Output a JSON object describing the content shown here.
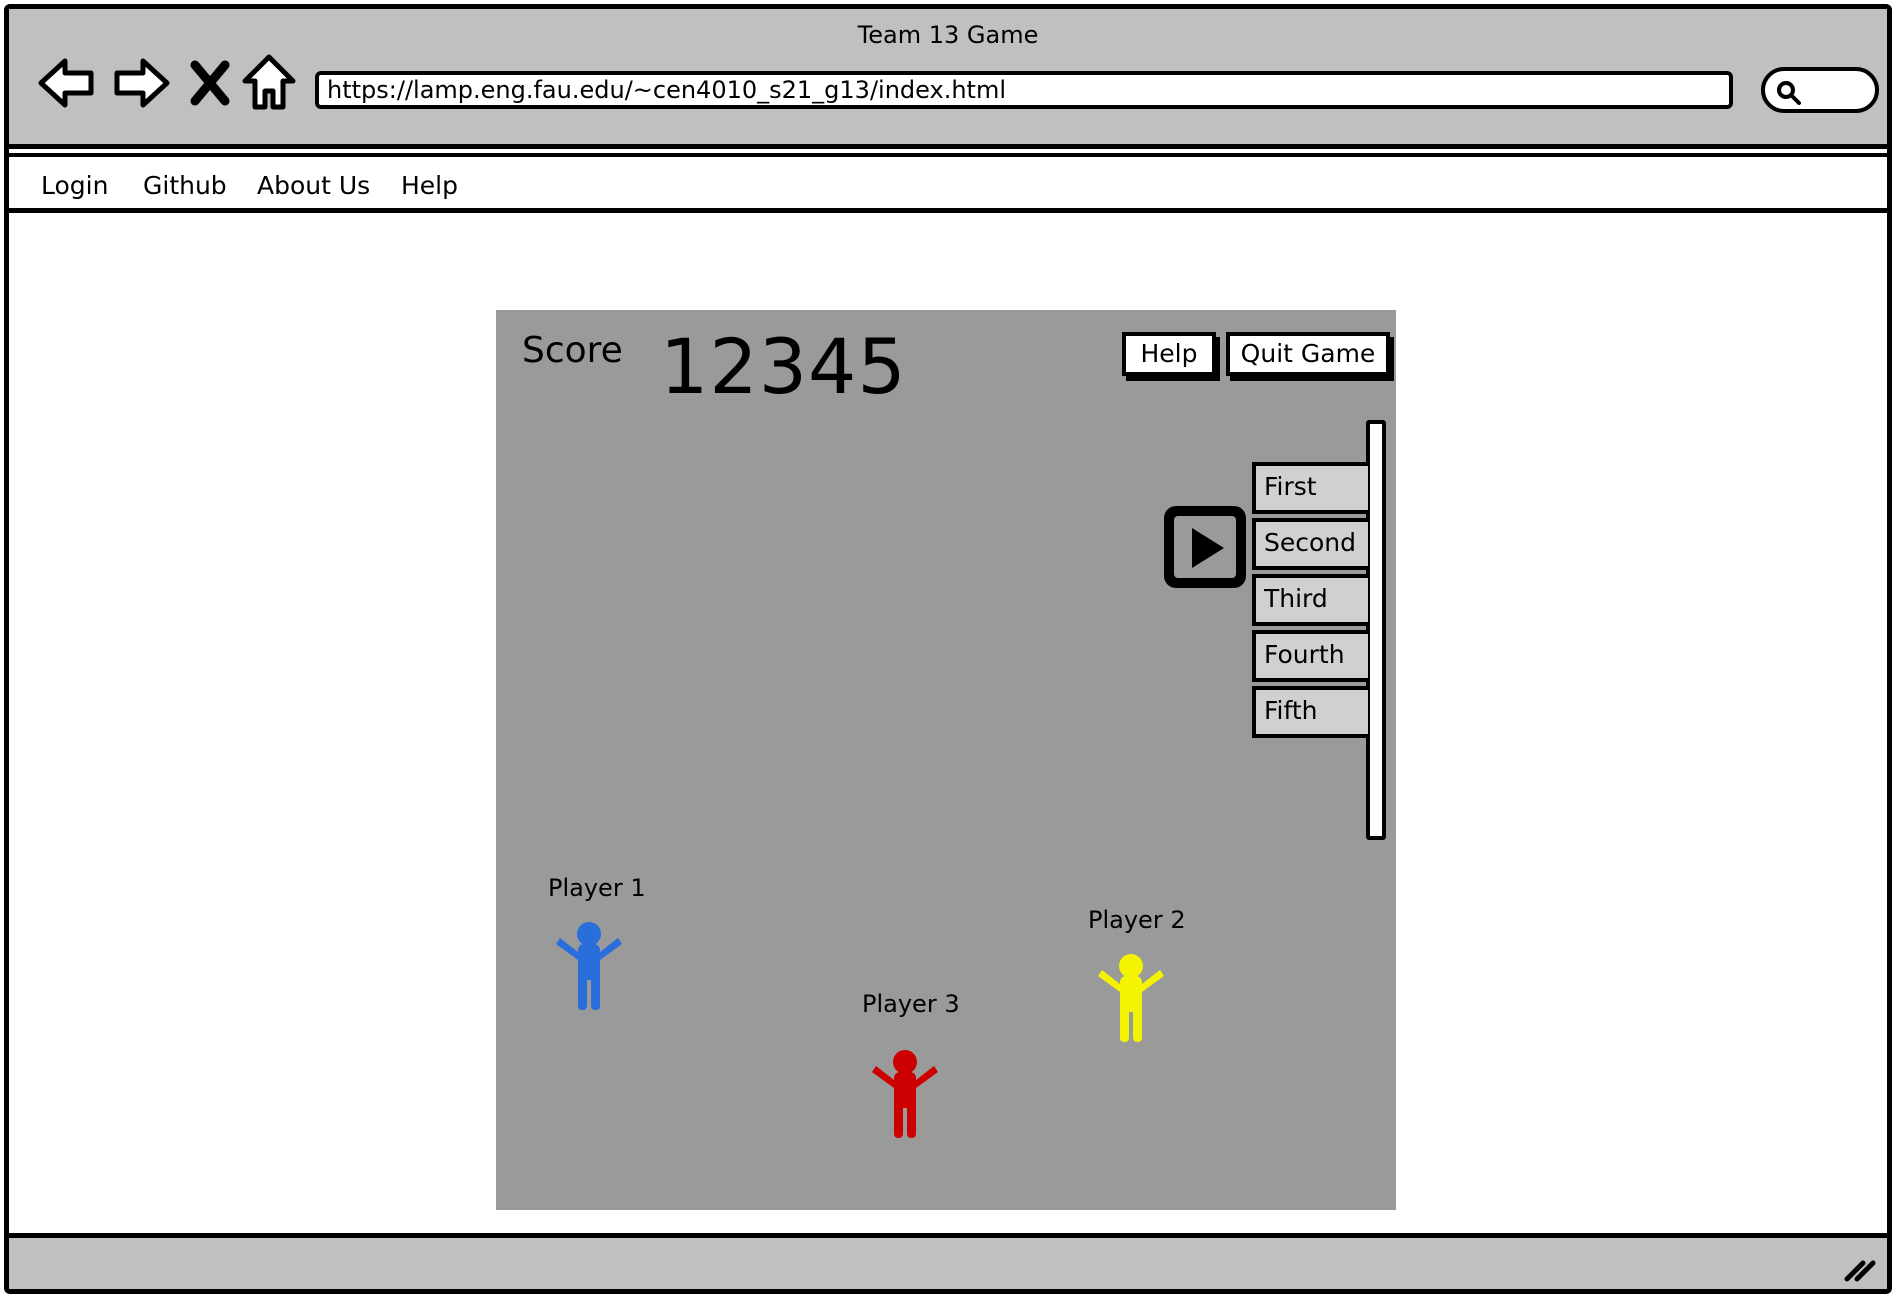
{
  "window": {
    "title": "Team 13 Game",
    "url": "https://lamp.eng.fau.edu/~cen4010_s21_g13/index.html"
  },
  "toolbar_icons": [
    "back-arrow-icon",
    "forward-arrow-icon",
    "close-x-icon",
    "home-icon",
    "search-icon"
  ],
  "menu": {
    "items": [
      "Login",
      "Github",
      "About Us",
      "Help"
    ]
  },
  "game": {
    "score_label": "Score",
    "score_value": "12345",
    "help_button": "Help",
    "quit_button": "Quit Game",
    "play_icon": "play-icon",
    "list_items": [
      "First",
      "Second",
      "Third",
      "Fourth",
      "Fifth"
    ],
    "players": [
      {
        "label": "Player 1",
        "color": "#2a6edb"
      },
      {
        "label": "Player 2",
        "color": "#f4f400"
      },
      {
        "label": "Player 3",
        "color": "#cc0000"
      }
    ],
    "background_color": "#9a9a9a"
  }
}
